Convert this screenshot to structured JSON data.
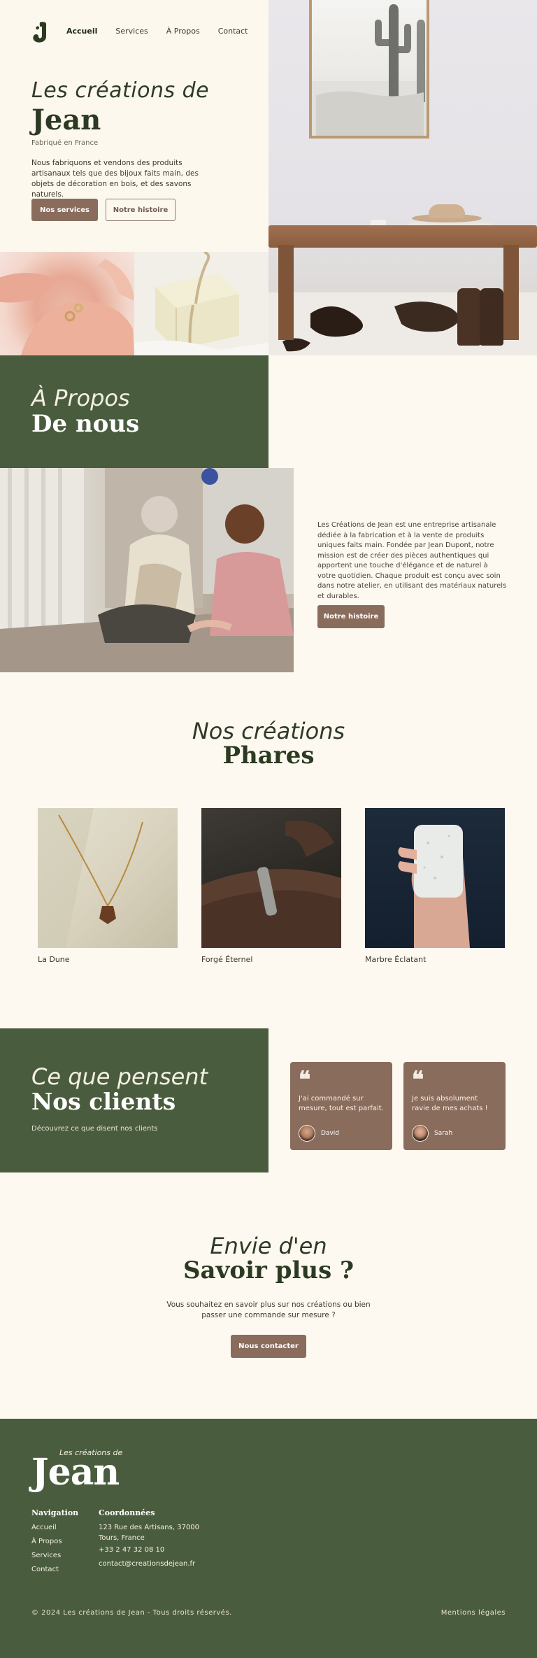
{
  "nav": {
    "items": [
      "Accueil",
      "Services",
      "À Propos",
      "Contact"
    ],
    "active": "Accueil"
  },
  "hero": {
    "script_title": "Les créations de",
    "big_title": "Jean",
    "subtitle": "Fabriqué en France",
    "description": "Nous fabriquons et vendons des produits artisanaux tels que des bijoux faits main, des objets de décoration en bois, et des savons naturels.",
    "primary_button": "Nos services",
    "secondary_button": "Notre histoire"
  },
  "about": {
    "script_title": "À Propos",
    "big_title": "De nous",
    "text": "Les Créations de Jean est une entreprise artisanale dédiée à la fabrication et à la vente de produits uniques faits main. Fondée par Jean Dupont, notre mission est de créer des pièces authentiques qui apportent une touche d'élégance et de naturel à votre quotidien. Chaque produit est conçu avec soin dans notre atelier, en utilisant des matériaux naturels et durables.",
    "button": "Notre histoire"
  },
  "creations": {
    "script_title": "Nos créations",
    "big_title": "Phares",
    "products": [
      {
        "name": "La Dune"
      },
      {
        "name": "Forgé Éternel"
      },
      {
        "name": "Marbre Éclatant"
      }
    ]
  },
  "testimonials": {
    "script_title": "Ce que pensent",
    "big_title": "Nos clients",
    "subtitle": "Découvrez ce que disent nos clients",
    "items": [
      {
        "quote": "J'ai commandé sur mesure, tout est parfait.",
        "author": "David"
      },
      {
        "quote": "Je suis absolument ravie de mes achats !",
        "author": "Sarah"
      }
    ]
  },
  "cta": {
    "script_title": "Envie d'en",
    "big_title": "Savoir plus ?",
    "text": "Vous souhaitez en savoir plus sur nos créations ou bien passer une commande sur mesure ?",
    "button": "Nous contacter"
  },
  "footer": {
    "logo_script": "Les créations de",
    "logo_big": "Jean",
    "nav_title": "Navigation",
    "nav_links": [
      "Accueil",
      "À Propos",
      "Services",
      "Contact"
    ],
    "contact_title": "Coordonnées",
    "address_line1": "123 Rue des Artisans, 37000",
    "address_line2": "Tours, France",
    "phone": "+33 2 47 32 08 10",
    "email": "contact@creationsdejean.fr",
    "copyright": "© 2024 Les créations de Jean - Tous droits réservés.",
    "legal": "Mentions légales"
  },
  "colors": {
    "cream": "#fdf9f0",
    "green": "#4a5c3e",
    "brown": "#8a6c5c",
    "dark_green_text": "#2c3a22"
  },
  "icons": [
    "logo-j-icon",
    "quote-icon"
  ]
}
